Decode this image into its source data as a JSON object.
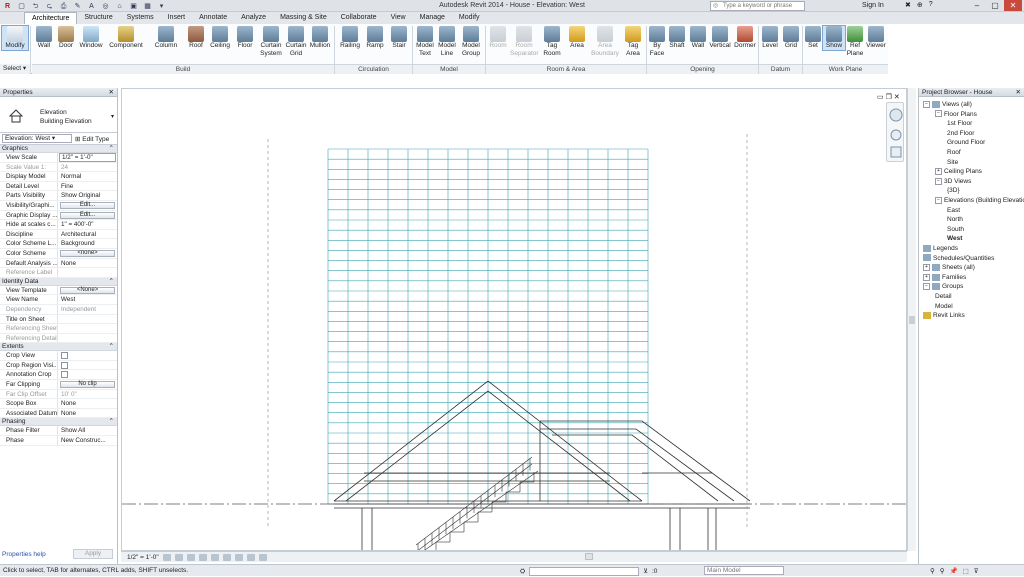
{
  "titlebar": {
    "app_title": "Autodesk Revit 2014 -   House - Elevation: West",
    "search_placeholder": "Type a keyword or phrase",
    "sign_in": "Sign In",
    "qat": [
      "R",
      "▢",
      "⮌",
      "⮎",
      "⎙",
      "✎",
      "A",
      "◎",
      "⌂",
      "▣",
      "▦",
      "▾"
    ],
    "right_icons": [
      "✖",
      "⊕",
      "?"
    ],
    "win": [
      "–",
      "▢",
      "✕"
    ]
  },
  "tabs": [
    "Architecture",
    "Structure",
    "Systems",
    "Insert",
    "Annotate",
    "Analyze",
    "Massing & Site",
    "Collaborate",
    "View",
    "Manage",
    "Modify"
  ],
  "ribbon": {
    "select": "Select",
    "panels": [
      "Build",
      "Circulation",
      "Model",
      "Room & Area",
      "Opening",
      "Datum",
      "Work Plane"
    ],
    "buttons": [
      "Modify",
      "Wall",
      "Door",
      "Window",
      "Component",
      "Column",
      "Roof",
      "Ceiling",
      "Floor",
      "Curtain System",
      "Curtain Grid",
      "Mullion",
      "Railing",
      "Ramp",
      "Stair",
      "Model Text",
      "Model Line",
      "Model Group",
      "Room",
      "Room Separator",
      "Tag Room",
      "Area",
      "Area Boundary",
      "Tag Area",
      "By Face",
      "Shaft",
      "Wall",
      "Vertical",
      "Dormer",
      "Level",
      "Grid",
      "Set",
      "Show",
      "Ref Plane",
      "Viewer"
    ]
  },
  "properties": {
    "header": "Properties",
    "type_line1": "Elevation",
    "type_line2": "Building Elevation",
    "view_selector": "Elevation: West",
    "edit_type": "Edit Type",
    "sections": {
      "graphics": "Graphics",
      "identity": "Identity Data",
      "extents": "Extents",
      "phasing": "Phasing"
    },
    "graphics_rows": [
      {
        "k": "View Scale",
        "v": "1/2\" = 1'-0\""
      },
      {
        "k": "Scale Value    1:",
        "v": "24"
      },
      {
        "k": "Display Model",
        "v": "Normal"
      },
      {
        "k": "Detail Level",
        "v": "Fine"
      },
      {
        "k": "Parts Visibility",
        "v": "Show Original"
      },
      {
        "k": "Visibility/Graphi...",
        "v": "Edit..."
      },
      {
        "k": "Graphic Display ...",
        "v": "Edit..."
      },
      {
        "k": "Hide at scales c...",
        "v": "1\" = 400'-0\""
      },
      {
        "k": "Discipline",
        "v": "Architectural"
      },
      {
        "k": "Color Scheme L...",
        "v": "Background"
      },
      {
        "k": "Color Scheme",
        "v": "<none>"
      },
      {
        "k": "Default Analysis ...",
        "v": "None"
      },
      {
        "k": "Reference Label",
        "v": ""
      }
    ],
    "identity_rows": [
      {
        "k": "View Template",
        "v": "<None>"
      },
      {
        "k": "View Name",
        "v": "West"
      },
      {
        "k": "Dependency",
        "v": "Independent"
      },
      {
        "k": "Title on Sheet",
        "v": ""
      },
      {
        "k": "Referencing Sheet",
        "v": ""
      },
      {
        "k": "Referencing Detail",
        "v": ""
      }
    ],
    "extents_rows": [
      {
        "k": "Crop View",
        "v": ""
      },
      {
        "k": "Crop Region Visi...",
        "v": ""
      },
      {
        "k": "Annotation Crop",
        "v": ""
      },
      {
        "k": "Far Clipping",
        "v": "No clip"
      },
      {
        "k": "Far Clip Offset",
        "v": "10'  0\""
      },
      {
        "k": "Scope Box",
        "v": "None"
      },
      {
        "k": "Associated Datum",
        "v": "None"
      }
    ],
    "phasing_rows": [
      {
        "k": "Phase Filter",
        "v": "Show All"
      },
      {
        "k": "Phase",
        "v": "New Construc..."
      }
    ],
    "help": "Properties help",
    "apply": "Apply"
  },
  "browser": {
    "header": "Project Browser - House",
    "nodes": [
      "Views (all)",
      "Floor Plans",
      "1st Floor",
      "2nd Floor",
      "Ground Floor",
      "Roof",
      "Site",
      "Ceiling Plans",
      "3D Views",
      "{3D}",
      "Elevations (Building Elevation)",
      "East",
      "North",
      "South",
      "West",
      "Legends",
      "Schedules/Quantities",
      "Sheets (all)",
      "Families",
      "Groups",
      "Detail",
      "Model",
      "Revit Links"
    ]
  },
  "view_control": {
    "scale": "1/2\" = 1'-0\""
  },
  "status": {
    "text": "Click to select, TAB for alternates, CTRL adds, SHIFT unselects.",
    "zero": ":0",
    "model": "Main Model"
  }
}
